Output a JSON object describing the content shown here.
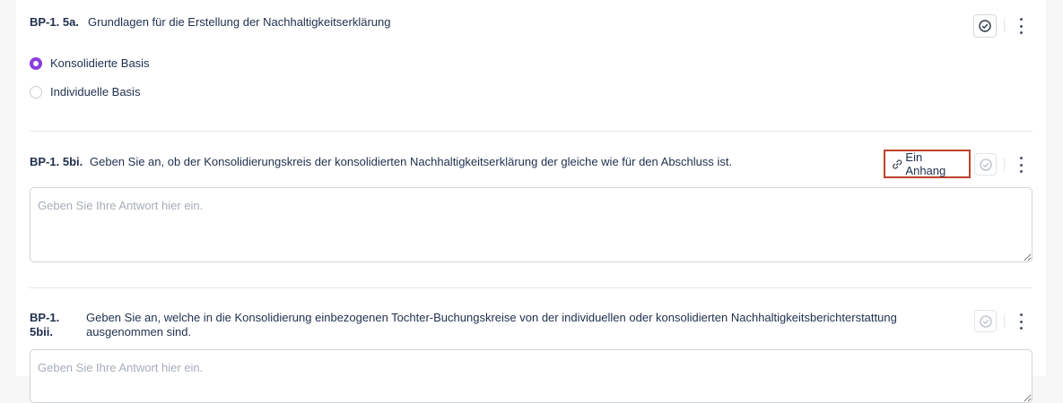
{
  "questions": [
    {
      "code": "BP-1. 5a.",
      "text": "Grundlagen für die Erstellung der Nachhaltigkeitserklärung",
      "options": [
        {
          "label": "Konsolidierte Basis",
          "selected": true
        },
        {
          "label": "Individuelle Basis",
          "selected": false
        }
      ]
    },
    {
      "code": "BP-1. 5bi.",
      "text": "Geben Sie an, ob der Konsolidierungskreis der konsolidierten Nachhaltigkeitserklärung der gleiche wie für den Abschluss ist.",
      "attachment_label": "Ein Anhang",
      "answer_placeholder": "Geben Sie Ihre Antwort hier ein."
    },
    {
      "code_line1": "BP-1.",
      "code_line2": "5bii.",
      "text": "Geben Sie an, welche in die Konsolidierung einbezogenen Tochter-Buchungskreise von der individuellen oder konsolidierten Nachhaltigkeitsberichterstattung ausgenommen sind.",
      "answer_placeholder": "Geben Sie Ihre Antwort hier ein."
    }
  ],
  "icons": {
    "complete": "check-circle-icon",
    "more": "more-vertical-icon",
    "attach": "link-icon"
  },
  "colors": {
    "accent": "#8a3ddb",
    "highlight_border": "#c0412a"
  }
}
